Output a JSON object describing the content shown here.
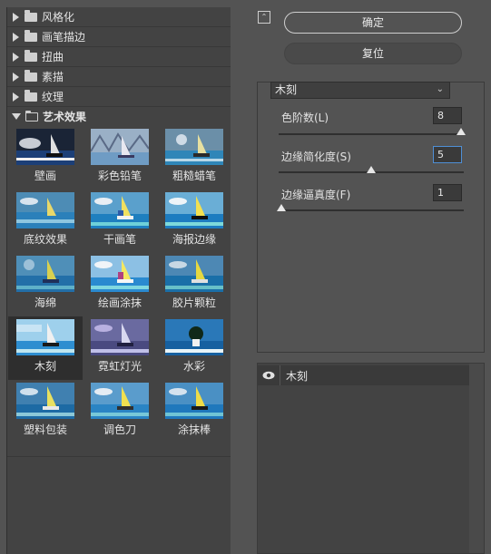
{
  "dialog": {
    "confirm_label": "确定",
    "reset_label": "复位",
    "collapse_glyph": "⌃"
  },
  "categories": [
    {
      "label": "风格化",
      "expanded": false
    },
    {
      "label": "画笔描边",
      "expanded": false
    },
    {
      "label": "扭曲",
      "expanded": false
    },
    {
      "label": "素描",
      "expanded": false
    },
    {
      "label": "纹理",
      "expanded": false
    },
    {
      "label": "艺术效果",
      "expanded": true
    }
  ],
  "filters": [
    {
      "label": "壁画"
    },
    {
      "label": "彩色铅笔"
    },
    {
      "label": "粗糙蜡笔"
    },
    {
      "label": "底纹效果"
    },
    {
      "label": "干画笔"
    },
    {
      "label": "海报边缘"
    },
    {
      "label": "海绵"
    },
    {
      "label": "绘画涂抹"
    },
    {
      "label": "胶片颗粒"
    },
    {
      "label": "木刻",
      "selected": true
    },
    {
      "label": "霓虹灯光"
    },
    {
      "label": "水彩"
    },
    {
      "label": "塑料包装"
    },
    {
      "label": "调色刀"
    },
    {
      "label": "涂抹棒"
    }
  ],
  "settings": {
    "filter_select": "木刻",
    "params": [
      {
        "label": "色阶数(L)",
        "value": "8",
        "fraction": 1.0
      },
      {
        "label": "边缘简化度(S)",
        "value": "5",
        "fraction": 0.5
      },
      {
        "label": "边缘逼真度(F)",
        "value": "1",
        "fraction": 0.0
      }
    ]
  },
  "layers": [
    {
      "name": "木刻",
      "visible": true
    }
  ],
  "colors": {
    "panel_bg": "#535353",
    "list_bg": "#434343",
    "selected_bg": "#2e2e2e",
    "focus_border": "#4f8fd6"
  }
}
